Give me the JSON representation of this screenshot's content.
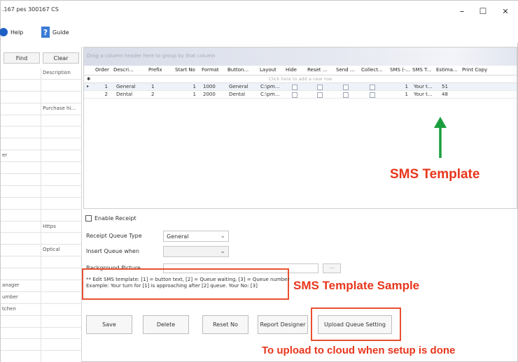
{
  "window": {
    "title": ".167 pes 300167 CS",
    "controls": {
      "minimize": "–",
      "maximize": "☐",
      "close": "✕"
    }
  },
  "toolbar": {
    "help_label": "Help",
    "guide_label": "Guide",
    "guide_glyph": "?"
  },
  "left_panel": {
    "find_label": "Find",
    "clear_label": "Clear",
    "rows": [
      {
        "c1": "",
        "c2": "Description"
      },
      {
        "c1": "",
        "c2": ""
      },
      {
        "c1": "",
        "c2": ""
      },
      {
        "c1": "",
        "c2": "Purchase hi..."
      },
      {
        "c1": "",
        "c2": ""
      },
      {
        "c1": "",
        "c2": ""
      },
      {
        "c1": "",
        "c2": ""
      },
      {
        "c1": "er",
        "c2": ""
      },
      {
        "c1": "",
        "c2": ""
      },
      {
        "c1": "",
        "c2": ""
      },
      {
        "c1": "",
        "c2": ""
      },
      {
        "c1": "",
        "c2": ""
      },
      {
        "c1": "",
        "c2": ""
      },
      {
        "c1": "",
        "c2": "Https"
      },
      {
        "c1": "",
        "c2": ""
      },
      {
        "c1": "",
        "c2": "Optical"
      },
      {
        "c1": "",
        "c2": ""
      },
      {
        "c1": "",
        "c2": ""
      },
      {
        "c1": "anager",
        "c2": ""
      },
      {
        "c1": "umber",
        "c2": ""
      },
      {
        "c1": "tchen",
        "c2": ""
      },
      {
        "c1": "",
        "c2": ""
      },
      {
        "c1": "",
        "c2": ""
      },
      {
        "c1": "",
        "c2": ""
      },
      {
        "c1": "",
        "c2": ""
      },
      {
        "c1": ".",
        "c2": ""
      }
    ]
  },
  "grid": {
    "group_hint": "Drag a column header here to group by that column",
    "new_row_hint": "Click here to add a new row",
    "columns": [
      "Order",
      "Descri...",
      "Prefix",
      "Start No",
      "Format",
      "Button...",
      "Layout",
      "Hide",
      "Reset ...",
      "Send ...",
      "Collect...",
      "SMS (-...",
      "SMS T...",
      "Estima...",
      "Print Copy"
    ],
    "rows": [
      {
        "order": "1",
        "desc": "General",
        "prefix": "1",
        "start_no": "1",
        "format": "1000",
        "button": "General",
        "layout": "C:\\pm...",
        "sms": "1",
        "sms_t": "Your t...",
        "estima": "51"
      },
      {
        "order": "2",
        "desc": "Dental",
        "prefix": "2",
        "start_no": "1",
        "format": "2000",
        "button": "Dental",
        "layout": "C:\\pm...",
        "sms": "1",
        "sms_t": "Your t...",
        "estima": "48"
      }
    ]
  },
  "form": {
    "enable_receipt_label": "Enable Receipt",
    "receipt_queue_type_label": "Receipt Queue Type",
    "receipt_queue_type_value": "General",
    "insert_queue_label": "Insert Queue when",
    "insert_queue_value": "",
    "background_label": "Background Picture",
    "browse_label": "...",
    "sms_note_line1": "** Edit SMS template: [1] = button text, [2] = Queue waiting, [3] = Queue number",
    "sms_note_line2": "Example: Your turn for [1] is approaching after [2] queue. Your No: [3]"
  },
  "buttons": {
    "save": "Save",
    "delete": "Delete",
    "reset_no": "Reset No",
    "report_designer": "Report Designer",
    "upload": "Upload Queue Setting"
  },
  "annotations": {
    "sms_template": "SMS Template",
    "sms_template_sample": "SMS Template Sample",
    "upload_note": "To upload to cloud when setup is done",
    "colors": {
      "red": "#e8361c",
      "green": "#1a9e3e"
    }
  }
}
